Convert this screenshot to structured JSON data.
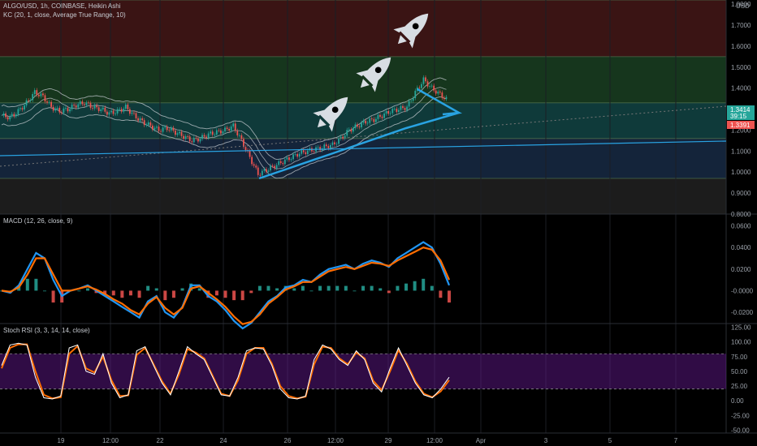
{
  "header": {
    "title": "ALGO/USD, 1h, COINBASE, Heikin Ashi",
    "indicator": "KC (20, 1, close, Average True Range, 10)",
    "currency": "USD"
  },
  "panes": {
    "macd": {
      "legend": "MACD (12, 26, close, 9)"
    },
    "rsi": {
      "legend": "Stoch RSI (3, 3, 14, 14, close)"
    }
  },
  "price_tags": {
    "last": "1.3414",
    "countdown": "39:15",
    "other": "1.3391"
  },
  "colors": {
    "background": "#000000",
    "grid": "#1b1e24",
    "candle_up": "#26a69a",
    "candle_down": "#ef5350",
    "keltner": "#c8cdd3",
    "trendline": "#29a3e2",
    "macd_line": "#2196f3",
    "signal_line": "#ff6d00",
    "rsi_k": "#ffffff",
    "rsi_d": "#ff6d00",
    "rsi_band": "#6a1b9a",
    "zone_red": "#3a1414",
    "zone_green": "#16361d",
    "zone_teal": "#0f3a3a",
    "zone_blue": "#14243a",
    "zone_gray": "#1c1c1c",
    "tag_last": "#26a69a",
    "tag_other": "#ef5350"
  },
  "icons": [
    "rocket-icon",
    "rocket-icon",
    "rocket-icon"
  ],
  "chart_data": [
    {
      "type": "candlestick",
      "title": "ALGO/USD, 1h, COINBASE, Heikin Ashi",
      "ylabel": "USD",
      "y_ticks": [
        "1.8000",
        "1.7000",
        "1.6000",
        "1.5000",
        "1.4000",
        "1.3000",
        "1.2000",
        "1.1000",
        "1.0000",
        "0.9000",
        "0.8000"
      ],
      "ylim": [
        0.8,
        1.82
      ],
      "x_ticks": [
        "19",
        "12:00",
        "22",
        "24",
        "26",
        "12:00",
        "29",
        "12:00",
        "Apr",
        "3",
        "5",
        "7"
      ],
      "series_close": [
        1.27,
        1.26,
        1.29,
        1.33,
        1.38,
        1.36,
        1.31,
        1.29,
        1.3,
        1.32,
        1.33,
        1.31,
        1.3,
        1.28,
        1.29,
        1.31,
        1.27,
        1.24,
        1.22,
        1.2,
        1.21,
        1.19,
        1.17,
        1.15,
        1.16,
        1.18,
        1.19,
        1.2,
        1.22,
        1.15,
        1.07,
        0.99,
        1.01,
        1.03,
        1.05,
        1.07,
        1.09,
        1.1,
        1.11,
        1.12,
        1.13,
        1.16,
        1.2,
        1.22,
        1.24,
        1.25,
        1.27,
        1.29,
        1.3,
        1.31,
        1.38,
        1.44,
        1.4,
        1.37,
        1.34
      ],
      "zones": [
        {
          "name": "red",
          "from": 1.55,
          "to": 1.82
        },
        {
          "name": "green",
          "from": 1.33,
          "to": 1.55
        },
        {
          "name": "teal",
          "from": 1.16,
          "to": 1.33
        },
        {
          "name": "blue",
          "from": 0.97,
          "to": 1.16
        },
        {
          "name": "gray",
          "from": 0.8,
          "to": 0.97
        }
      ],
      "grid": true
    },
    {
      "type": "line",
      "title": "MACD (12, 26, close, 9)",
      "y_ticks": [
        "0.0600",
        "0.0400",
        "0.0200",
        "-0.0000",
        "-0.0200"
      ],
      "ylim": [
        -0.0305,
        0.0665
      ],
      "series": [
        {
          "values": [
            0,
            -0.002,
            0.005,
            0.02,
            0.035,
            0.03,
            0.01,
            -0.005,
            0,
            0.002,
            0.005,
            0,
            -0.005,
            -0.01,
            -0.015,
            -0.02,
            -0.025,
            -0.01,
            -0.005,
            -0.02,
            -0.025,
            -0.015,
            0.005,
            0.005,
            -0.005,
            -0.01,
            -0.018,
            -0.028,
            -0.035,
            -0.03,
            -0.02,
            -0.01,
            -0.005,
            0.003,
            0.005,
            0.01,
            0.008,
            0.015,
            0.02,
            0.022,
            0.024,
            0.02,
            0.025,
            0.028,
            0.026,
            0.022,
            0.03,
            0.035,
            0.04,
            0.045,
            0.04,
            0.025,
            0.005
          ]
        },
        {
          "values": [
            0,
            -0.001,
            0.003,
            0.015,
            0.03,
            0.03,
            0.015,
            0,
            0,
            0.002,
            0.004,
            0.001,
            -0.003,
            -0.008,
            -0.012,
            -0.018,
            -0.022,
            -0.012,
            -0.006,
            -0.016,
            -0.022,
            -0.016,
            0.002,
            0.004,
            -0.002,
            -0.008,
            -0.015,
            -0.024,
            -0.031,
            -0.029,
            -0.022,
            -0.012,
            -0.006,
            0.001,
            0.004,
            0.008,
            0.008,
            0.013,
            0.018,
            0.02,
            0.022,
            0.02,
            0.023,
            0.026,
            0.025,
            0.023,
            0.028,
            0.032,
            0.036,
            0.04,
            0.038,
            0.028,
            0.01
          ]
        }
      ],
      "grid": true
    },
    {
      "type": "line",
      "title": "Stoch RSI (3, 3, 14, 14, close)",
      "y_ticks": [
        "125.00",
        "100.00",
        "75.00",
        "50.00",
        "25.00",
        "0.00",
        "-25.00",
        "-50.00"
      ],
      "ylim": [
        -55,
        130
      ],
      "band": [
        20,
        80
      ],
      "series": [
        {
          "values": [
            60,
            95,
            98,
            95,
            40,
            5,
            3,
            8,
            90,
            95,
            50,
            45,
            80,
            30,
            5,
            10,
            85,
            92,
            60,
            30,
            10,
            50,
            92,
            80,
            70,
            40,
            10,
            8,
            40,
            85,
            90,
            88,
            60,
            20,
            5,
            3,
            8,
            70,
            95,
            88,
            70,
            60,
            85,
            70,
            30,
            15,
            55,
            90,
            60,
            30,
            10,
            5,
            20,
            40
          ]
        },
        {
          "values": [
            55,
            90,
            96,
            96,
            50,
            10,
            4,
            6,
            80,
            93,
            55,
            48,
            75,
            35,
            8,
            9,
            78,
            90,
            62,
            33,
            12,
            45,
            88,
            82,
            72,
            42,
            12,
            8,
            35,
            80,
            90,
            90,
            63,
            25,
            8,
            4,
            7,
            62,
            92,
            90,
            72,
            62,
            82,
            72,
            34,
            18,
            50,
            86,
            63,
            33,
            12,
            6,
            16,
            35
          ]
        }
      ],
      "grid": true
    }
  ]
}
